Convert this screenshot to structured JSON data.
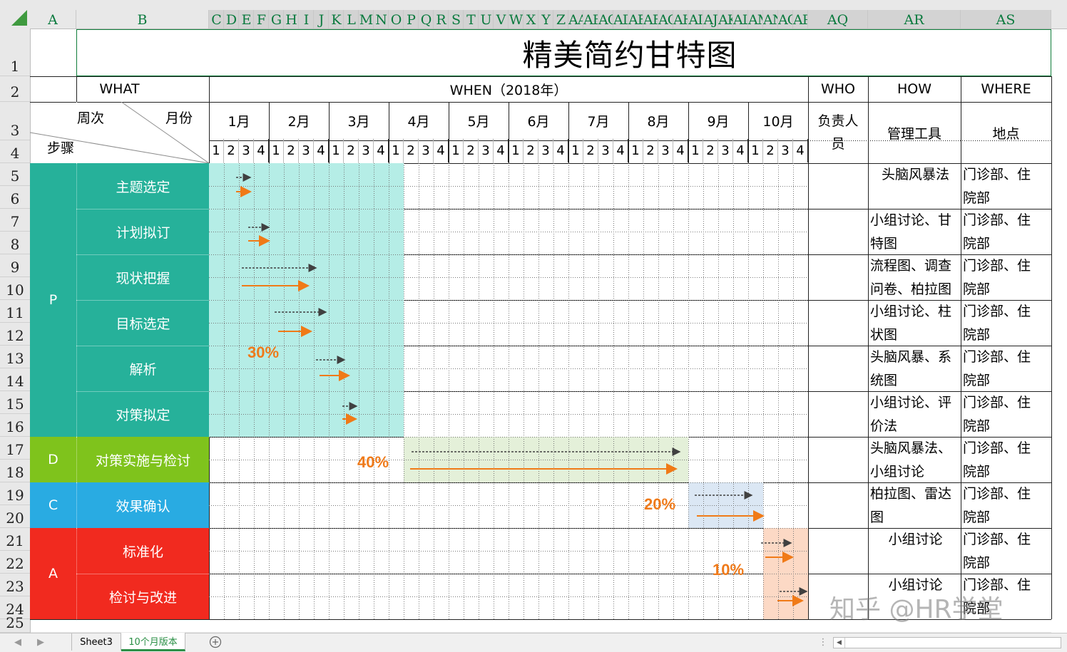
{
  "column_headers": [
    "A",
    "B",
    "C",
    "D",
    "E",
    "F",
    "G",
    "H",
    "I",
    "J",
    "K",
    "L",
    "M",
    "N",
    "O",
    "P",
    "Q",
    "R",
    "S",
    "T",
    "U",
    "V",
    "W",
    "X",
    "Y",
    "Z",
    "AA",
    "AB",
    "AC",
    "AD",
    "AE",
    "AF",
    "AG",
    "AH",
    "AI",
    "AJ",
    "AK",
    "AL",
    "AM",
    "AN",
    "AO",
    "AP",
    "AQ",
    "AR",
    "AS"
  ],
  "row_headers": [
    "1",
    "2",
    "3",
    "4",
    "5",
    "6",
    "7",
    "8",
    "9",
    "10",
    "11",
    "12",
    "13",
    "14",
    "15",
    "16",
    "17",
    "18",
    "19",
    "20",
    "21",
    "22",
    "23",
    "24",
    "25"
  ],
  "title": "精美简约甘特图",
  "headers": {
    "what": "WHAT",
    "when": "WHEN（2018年）",
    "who": "WHO",
    "how": "HOW",
    "where": "WHERE",
    "week_label": "周次",
    "month_label": "月份",
    "step_label": "步骤",
    "owner": "负责人员",
    "tool": "管理工具",
    "location": "地点"
  },
  "months": [
    "1月",
    "2月",
    "3月",
    "4月",
    "5月",
    "6月",
    "7月",
    "8月",
    "9月",
    "10月"
  ],
  "weeks": [
    "1",
    "2",
    "3",
    "4"
  ],
  "phases": [
    {
      "label": "P",
      "color": "#26b19a"
    },
    {
      "label": "D",
      "color": "#7fc31c"
    },
    {
      "label": "C",
      "color": "#29abe2"
    },
    {
      "label": "A",
      "color": "#f12a1f"
    }
  ],
  "tasks": [
    {
      "name": "主题选定",
      "how": [
        "头脑风暴法"
      ],
      "where": [
        "门诊部、住",
        "院部"
      ]
    },
    {
      "name": "计划拟订",
      "how": [
        "小组讨论、甘",
        "特图"
      ],
      "where": [
        "门诊部、住",
        "院部"
      ]
    },
    {
      "name": "现状把握",
      "how": [
        "流程图、调查",
        "问卷、柏拉图"
      ],
      "where": [
        "门诊部、住",
        "院部"
      ]
    },
    {
      "name": "目标选定",
      "how": [
        "小组讨论、柱",
        "状图"
      ],
      "where": [
        "门诊部、住",
        "院部"
      ]
    },
    {
      "name": "解析",
      "how": [
        "头脑风暴、系",
        "统图"
      ],
      "where": [
        "门诊部、住",
        "院部"
      ]
    },
    {
      "name": "对策拟定",
      "how": [
        "小组讨论、评",
        "价法"
      ],
      "where": [
        "门诊部、住",
        "院部"
      ]
    },
    {
      "name": "对策实施与检讨",
      "how": [
        "头脑风暴法、",
        "小组讨论"
      ],
      "where": [
        "门诊部、住",
        "院部"
      ]
    },
    {
      "name": "效果确认",
      "how": [
        "柏拉图、雷达",
        "图"
      ],
      "where": [
        "门诊部、住",
        "院部"
      ]
    },
    {
      "name": "标准化",
      "how": [
        "小组讨论"
      ],
      "where": [
        "门诊部、住",
        "院部"
      ]
    },
    {
      "name": "检讨与改进",
      "how": [
        "小组讨论"
      ],
      "where": [
        "门诊部、住",
        "院部"
      ]
    }
  ],
  "percentages": [
    "30%",
    "40%",
    "20%",
    "10%"
  ],
  "band_colors": {
    "p": "#b5ede6",
    "d": "#e4f0d9",
    "c": "#dbe7f4",
    "a": "#fcd9c5"
  },
  "arrow_colors": {
    "plan": "#404040",
    "actual": "#f07a17"
  },
  "tabs": {
    "sheet3": "Sheet3",
    "active": "10个月版本"
  },
  "add_sheet_icon": "plus-circle-icon",
  "watermark": "知乎 @HR学堂"
}
